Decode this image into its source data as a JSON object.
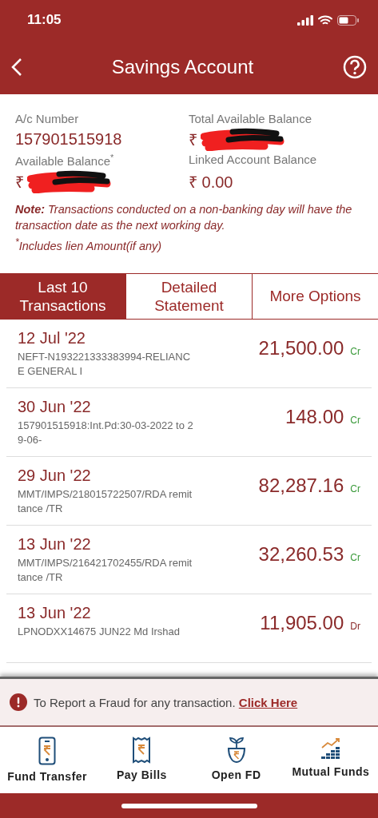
{
  "status_bar": {
    "time": "11:05"
  },
  "header": {
    "title": "Savings Account"
  },
  "account": {
    "number_label": "A/c Number",
    "number": "157901515918",
    "total_label": "Total Available Balance",
    "total_value": "₹",
    "available_label": "Available Balance$^{*}$",
    "available_value": "₹",
    "linked_label": "Linked Account Balance",
    "linked_value": "₹ 0.00",
    "note": "**Note:** Transactions conducted on a non-banking day will have the transaction date as the next working day.",
    "footnote": "$^{*}$Includes lien Amount(if any)"
  },
  "tabs": [
    {
      "label": "Last 10 Transactions",
      "selected": true
    },
    {
      "label": "Detailed Statement",
      "selected": false
    },
    {
      "label": "More Options",
      "selected": false
    }
  ],
  "transactions": [
    {
      "date": "12 Jul '22",
      "description": "NEFT-N193221333383994-RELIANCE GENERAL I",
      "amount": "21,500.00",
      "type": "Cr"
    },
    {
      "date": "30 Jun '22",
      "description": "157901515918:Int.Pd:30-03-2022 to 29-06-",
      "amount": "148.00",
      "type": "Cr"
    },
    {
      "date": "29 Jun '22",
      "description": "MMT/IMPS/218015722507/RDA remittance /TR",
      "amount": "82,287.16",
      "type": "Cr"
    },
    {
      "date": "13 Jun '22",
      "description": "MMT/IMPS/216421702455/RDA remittance /TR",
      "amount": "32,260.53",
      "type": "Cr"
    },
    {
      "date": "13 Jun '22",
      "description": "LPNODXX14675 JUN22 Md Irshad",
      "amount": "11,905.00",
      "type": "Dr"
    }
  ],
  "fraud_banner": {
    "text": "To Report a Fraud for any transaction.",
    "link": "Click Here"
  },
  "bottom_nav": [
    {
      "label": "Fund Transfer",
      "kind": "phone"
    },
    {
      "label": "Pay Bills",
      "kind": "bill"
    },
    {
      "label": "Open FD",
      "kind": "plant"
    },
    {
      "label": "Mutual Funds",
      "kind": "chart"
    }
  ]
}
